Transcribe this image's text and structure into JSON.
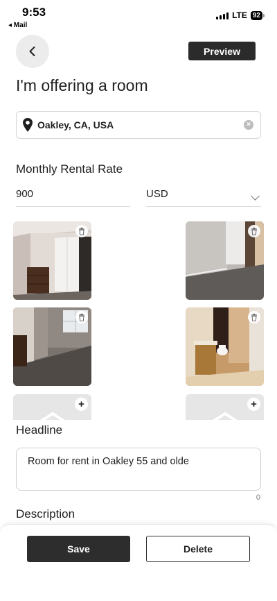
{
  "status_bar": {
    "time": "9:53",
    "back_app": "◂ Mail",
    "network": "LTE",
    "battery": "92"
  },
  "header": {
    "back_icon": "chevron-left-icon",
    "preview_label": "Preview",
    "title": "I'm offering a room"
  },
  "location": {
    "value": "Oakley, CA, USA",
    "icon": "location-pin-icon",
    "clear_icon": "clear-icon"
  },
  "rental": {
    "label": "Monthly Rental Rate",
    "amount": "900",
    "currency": "USD"
  },
  "photos": [
    {
      "name": "photo-bedroom-1",
      "has_delete": true
    },
    {
      "name": "photo-room-2",
      "has_delete": true
    },
    {
      "name": "photo-bedroom-3",
      "has_delete": true
    },
    {
      "name": "photo-bathroom-4",
      "has_delete": true
    }
  ],
  "headline": {
    "label": "Headline",
    "value": "Room for rent in Oakley 55 and olde",
    "char_count": "0"
  },
  "description": {
    "label": "Description"
  },
  "actions": {
    "save_label": "Save",
    "delete_label": "Delete"
  },
  "colors": {
    "primary_button": "#2d2d2d",
    "back_button_bg": "#ececec",
    "border": "#d6d6d6"
  }
}
